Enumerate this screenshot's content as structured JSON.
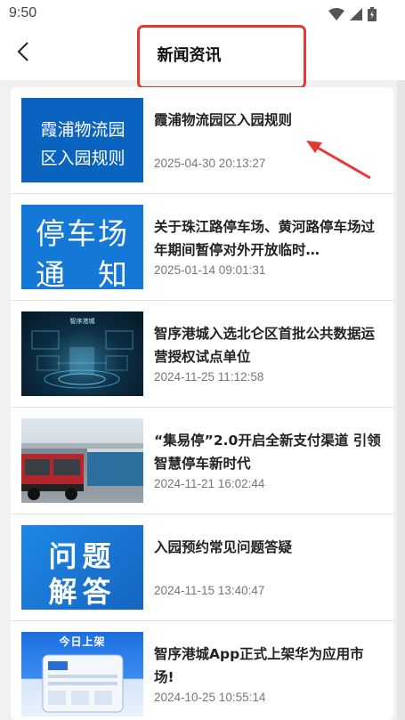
{
  "status_bar": {
    "time": "9:50"
  },
  "header": {
    "title": "新闻资讯"
  },
  "thumbnails": {
    "item1": "霞浦物流园区入园规则",
    "item2": [
      "停车场",
      "通　知"
    ],
    "item3": "智序港城",
    "item5": [
      "问题",
      "解答"
    ],
    "item6": "今日上架"
  },
  "news": [
    {
      "title": "霞浦物流园区入园规则",
      "date": "2025-04-30 20:13:27"
    },
    {
      "title": "关于珠江路停车场、黄河路停车场过年期间暂停对外开放临时…",
      "date": "2025-01-14 09:01:31"
    },
    {
      "title": "智序港城入选北仑区首批公共数据运营授权试点单位",
      "date": "2024-11-25 11:12:58"
    },
    {
      "title": "“集易停”2.0开启全新支付渠道 引领智慧停车新时代",
      "date": "2024-11-21 16:02:44"
    },
    {
      "title": "入园预约常见问题答疑",
      "date": "2024-11-15 13:40:47"
    },
    {
      "title": "智序港城App正式上架华为应用市场!",
      "date": "2024-10-25 10:55:14"
    }
  ],
  "colors": {
    "accent_highlight": "#e53935",
    "thumb_blue": "#0a63bf"
  }
}
